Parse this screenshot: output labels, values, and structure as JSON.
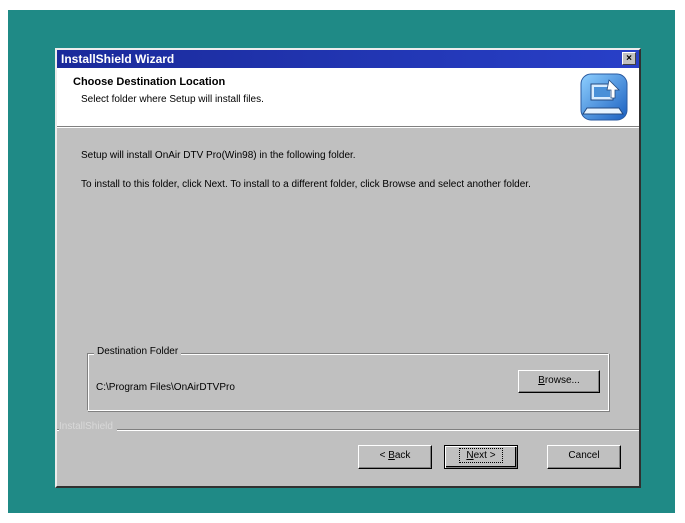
{
  "window": {
    "title": "InstallShield Wizard",
    "close_glyph": "×"
  },
  "header": {
    "title": "Choose Destination Location",
    "subtitle": "Select folder where Setup will install files.",
    "icon": "setup-computer-icon"
  },
  "body": {
    "line1": "Setup will install OnAir DTV Pro(Win98) in the following folder.",
    "line2": "To install to this folder, click Next. To install to a different folder, click Browse and select another folder."
  },
  "destination": {
    "legend": "Destination Folder",
    "path": "C:\\Program Files\\OnAirDTVPro",
    "browse_label": "rowse...",
    "browse_hotkey": "B"
  },
  "footer": {
    "brand": "InstallShield",
    "back_prefix": "< ",
    "back_hotkey": "B",
    "back_rest": "ack",
    "next_hotkey": "N",
    "next_rest": "ext >",
    "cancel_label": "Cancel"
  },
  "colors": {
    "desktop": "#1f8a86",
    "titlebar": "#1a2a9a",
    "face": "#c0c0c0"
  }
}
